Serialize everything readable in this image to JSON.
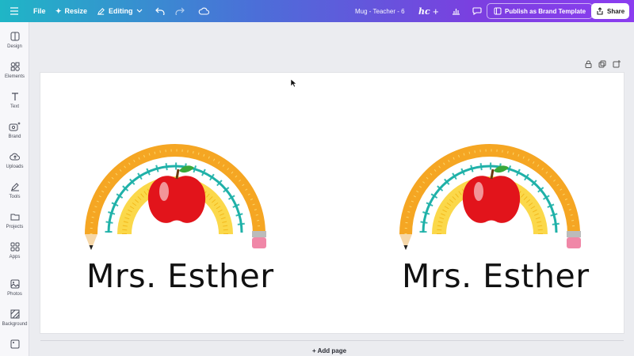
{
  "topbar": {
    "file_label": "File",
    "resize_label": "Resize",
    "editing_label": "Editing",
    "doc_title": "Mug - Teacher - 6",
    "hc_label": "hc",
    "plus_label": "+",
    "publish_label": "Publish as Brand Template",
    "share_label": "Share"
  },
  "sidebar": {
    "items": [
      {
        "label": "Design",
        "icon": "design-icon"
      },
      {
        "label": "Elements",
        "icon": "elements-icon"
      },
      {
        "label": "Text",
        "icon": "text-icon"
      },
      {
        "label": "Brand",
        "icon": "brand-icon"
      },
      {
        "label": "Uploads",
        "icon": "uploads-icon"
      },
      {
        "label": "Tools",
        "icon": "tools-icon"
      },
      {
        "label": "Projects",
        "icon": "projects-icon"
      },
      {
        "label": "Apps",
        "icon": "apps-icon"
      },
      {
        "label": "Photos",
        "icon": "photos-icon"
      },
      {
        "label": "Background",
        "icon": "background-icon"
      }
    ]
  },
  "canvas": {
    "designs": [
      {
        "name": "Mrs. Esther"
      },
      {
        "name": "Mrs. Esther"
      }
    ],
    "add_page_label": "+ Add page"
  },
  "colors": {
    "pencil_orange": "#f5a623",
    "teal_loops": "#1fb1a8",
    "yellow_ruler": "#fbd84a",
    "apple_red": "#e2141b"
  }
}
